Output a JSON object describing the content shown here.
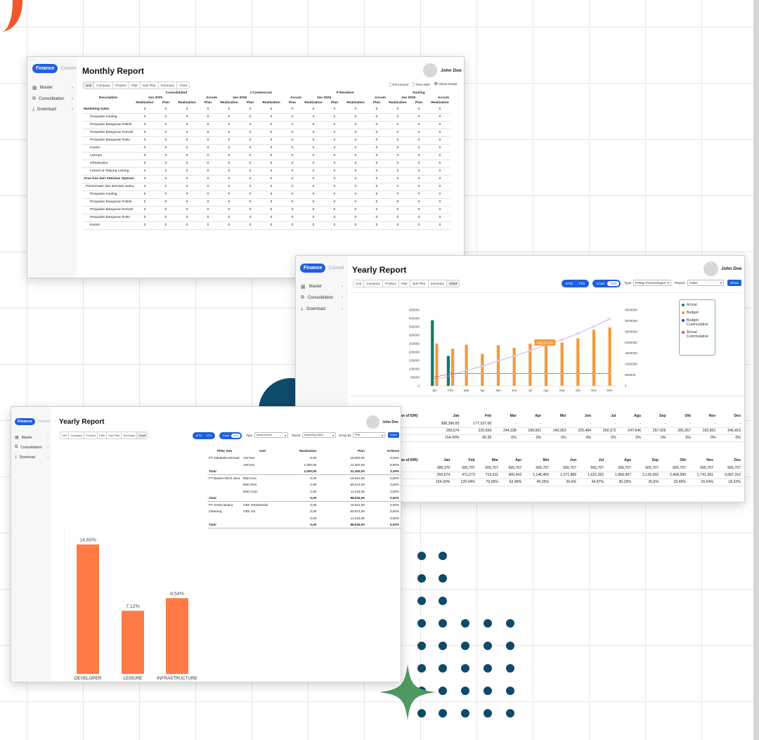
{
  "colors": {
    "accent": "#1f5fe0",
    "green": "#0f7a5f",
    "orange": "#f29a3a",
    "bar_orange": "#ff7a45",
    "navy": "#0e4a6a"
  },
  "app": {
    "logo_primary": "Finance",
    "logo_secondary": "Consol"
  },
  "nav": [
    {
      "label": "Master",
      "icon": "grid-icon"
    },
    {
      "label": "Consolidation",
      "icon": "layers-icon"
    },
    {
      "label": "Download",
      "icon": "download-icon"
    }
  ],
  "monthly": {
    "title": "Monthly Report",
    "user": "John Doe",
    "tabs": [
      "Unit",
      "Company",
      "Product",
      "Pilar",
      "Sub Pilar",
      "Summary",
      "Chart"
    ],
    "actions": [
      "Print Excel",
      "Print PDF",
      "Show Detail"
    ],
    "groups": [
      "Consolidated",
      "J Commercial",
      "P Resident",
      "Kavling"
    ],
    "accum": "Accum",
    "period": "Jan 2025",
    "description": "Description",
    "realization": "Realization",
    "plan": "Plan",
    "rows": [
      {
        "label": "Marketing Sales",
        "group": true
      },
      {
        "label": "Penjualan Kavling"
      },
      {
        "label": "Penjualan Bangunan Pabrik"
      },
      {
        "label": "Penjualan Bangunan Rumah"
      },
      {
        "label": "Penjualan Bangunan Ruko"
      },
      {
        "label": "Kantor"
      },
      {
        "label": "Lainnya"
      },
      {
        "label": "Infrastruktur"
      },
      {
        "label": "Leisure & Tanjung Lesung"
      },
      {
        "label": "Arus Kas dari Aktivitas Operasi",
        "group": true
      },
      {
        "label": "Penerimaan dari akrivitas usaha",
        "mid": true
      },
      {
        "label": "Penjualan Kavling"
      },
      {
        "label": "Penjualan Bangunan Pabrik"
      },
      {
        "label": "Penjualan Bangunan Rumah"
      },
      {
        "label": "Penjualan Bangunan Ruko"
      },
      {
        "label": "Kantor"
      }
    ],
    "cell_value": "0"
  },
  "yearly_chart": {
    "title": "Yearly Report",
    "user": "John Doe",
    "tabs": [
      "Unit",
      "Company",
      "Product",
      "Pilar",
      "Sub Pilar",
      "Summary",
      "Chart"
    ],
    "mtd": "MTD",
    "ytd": "YTD",
    "chart_toggle": "Chart",
    "grid_toggle": "Grid",
    "type_label": "Type",
    "type_value": "Rekap Perbandingan",
    "report_label": "Report",
    "report_value": "Sales",
    "show": "Show",
    "tooltip": "250,372.00",
    "table1": {
      "header_first": "an of IDR)",
      "months": [
        "Jan",
        "Feb",
        "Mar",
        "Apr",
        "Mei",
        "Jun",
        "Jul",
        "Agu",
        "Sep",
        "Okt",
        "Nov",
        "Des"
      ],
      "rows": [
        [
          "388,396.83",
          "177,337.06",
          "-",
          "-",
          "-",
          "-",
          "-",
          "-",
          "-",
          "-",
          "-",
          "-"
        ],
        [
          "250,674",
          "220,559",
          "244,338",
          "189,831",
          "240,963",
          "225,484",
          "250,372",
          "247,646",
          "257,026",
          "281,657",
          "332,801",
          "345,919"
        ],
        [
          "154.93%",
          "80.39",
          "0%",
          "0%",
          "0%",
          "0%",
          "0%",
          "0%",
          "0%",
          "0%",
          "0%",
          "0%"
        ]
      ]
    },
    "table2": {
      "header_first": "an of IDR)",
      "rows": [
        [
          "388,370",
          "565,707",
          "565,707",
          "565,707",
          "565,707",
          "565,707",
          "565,707",
          "565,707",
          "565,707",
          "565,707",
          "565,707",
          "565,707"
        ],
        [
          "250,674",
          "471,273",
          "715,611",
          "905,442",
          "1,146,405",
          "1,371,889",
          "1,622,262",
          "1,869,907",
          "2,126,933",
          "2,408,590",
          "2,741,391",
          "3,087,310"
        ],
        [
          "154,93%",
          "120.04%",
          "79,05%",
          "62,48%",
          "49,35%",
          "26,6%",
          "34,87%",
          "30,25%",
          "26,6%",
          "23,49%",
          "20,64%",
          "18,32%"
        ]
      ]
    }
  },
  "chart_data": [
    {
      "type": "bar",
      "categories": [
        "Jan",
        "Feb",
        "Mar",
        "Apr",
        "Mei",
        "Jun",
        "Jul",
        "Agu",
        "Sep",
        "Okt",
        "Nov",
        "Des"
      ],
      "series": [
        {
          "name": "Actual",
          "axis": "left",
          "color": "#0f7a5f",
          "values": [
            388397,
            177337,
            0,
            0,
            0,
            0,
            0,
            0,
            0,
            0,
            0,
            0
          ]
        },
        {
          "name": "Budget",
          "axis": "left",
          "color": "#f29a3a",
          "values": [
            250674,
            220559,
            244338,
            189831,
            240963,
            225484,
            250372,
            247646,
            257026,
            281657,
            332801,
            345919
          ]
        },
        {
          "name": "Budget Cummulative",
          "axis": "right",
          "type": "line",
          "color": "#a9a6ee",
          "values": [
            250674,
            471273,
            715611,
            905442,
            1146405,
            1371889,
            1622262,
            1869907,
            2126933,
            2408590,
            2741391,
            3087310
          ]
        },
        {
          "name": "Actual Cummulative",
          "axis": "right",
          "type": "line",
          "color": "#e3545a",
          "values": [
            388370,
            565707,
            565707,
            565707,
            565707,
            565707,
            565707,
            565707,
            565707,
            565707,
            565707,
            565707
          ]
        }
      ],
      "yticks_left": [
        "450000",
        "400000",
        "350000",
        "300000",
        "250000",
        "200000",
        "150000",
        "100000",
        "50000",
        "0"
      ],
      "yticks_right": [
        "3500000",
        "3000000",
        "2500000",
        "2000000",
        "1500000",
        "1000000",
        "500000",
        "0"
      ],
      "ylim_left": [
        0,
        450000
      ],
      "ylim_right": [
        0,
        3500000
      ],
      "legend": "right"
    },
    {
      "type": "bar",
      "categories": [
        "DEVELOPER",
        "LEISURE",
        "INFRASTRUCTURE"
      ],
      "values": [
        14.6,
        7.12,
        8.54
      ],
      "labels": [
        "14,60%",
        "7,12%",
        "8,54%"
      ],
      "color": "#ff7a45",
      "ylim": [
        0,
        16
      ]
    }
  ],
  "yearly_ach": {
    "title": "Yearly Report",
    "user": "John Doe",
    "tabs": [
      "Unit",
      "Company",
      "Product",
      "Pilar",
      "Sub Pilar",
      "Summary",
      "Chart"
    ],
    "mtd": "MTD",
    "ytd": "YTD",
    "chart_toggle": "Chart",
    "grid_toggle": "Grid",
    "type_label": "Type",
    "type_value": "Achievement",
    "report_label": "Report",
    "report_value": "Marketing Sales",
    "group_label": "Group By",
    "group_value": "Pilar",
    "show": "Show",
    "columns": [
      "Pillar Sub",
      "Unit",
      "Realization",
      "Plan",
      "Achieve"
    ],
    "rows": [
      [
        "PT Jababeka Morotai",
        "AM Res",
        "0,00",
        "18,900,00",
        "0,00%"
      ],
      [
        "",
        "AM Kav",
        "1,000,00",
        "12,500,00",
        "8,00%"
      ],
      [
        "Total",
        "",
        "1,000,00",
        "31,400,00",
        "3,18%"
      ],
      [
        "PT Banten West Java",
        "BWJ Kav",
        "0,00",
        "16.621,00",
        "0,00%"
      ],
      [
        "",
        "BWJ Res",
        "0,00",
        "60.672,00",
        "0,00%"
      ],
      [
        "",
        "BWJ Com",
        "0,00",
        "11.242,00",
        "0,00%"
      ],
      [
        "Total",
        "",
        "0,00",
        "88.535,00",
        "0,00%"
      ],
      [
        "PT Graha Buana",
        "GBC Residensial",
        "0,00",
        "16.621,00",
        "0,00%"
      ],
      [
        "Cikarang",
        "GBC K9",
        "0,00",
        "60.672,00",
        "0,00%"
      ],
      [
        "",
        "",
        "0,00",
        "11.242,00",
        "0,00%"
      ],
      [
        "Total",
        "",
        "0,00",
        "88.535,00",
        "0,00%"
      ]
    ]
  }
}
